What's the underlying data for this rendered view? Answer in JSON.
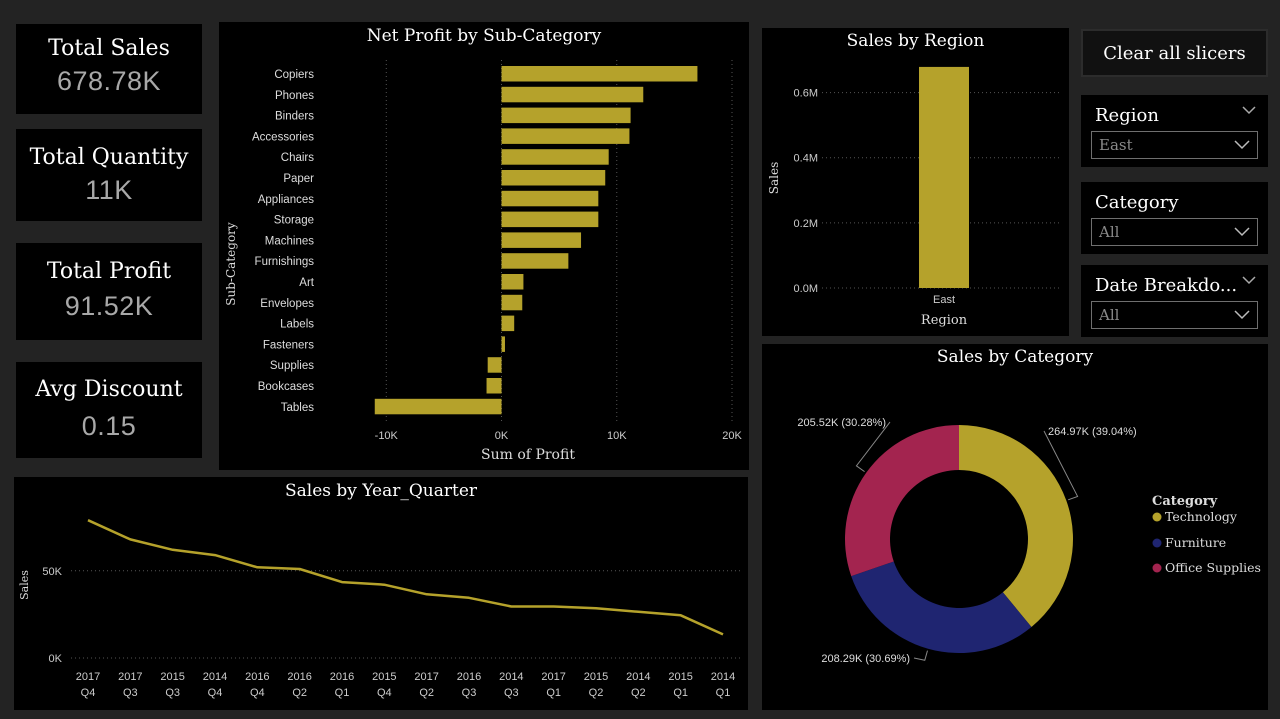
{
  "kpis": {
    "total_sales": {
      "label": "Total Sales",
      "value": "678.78K"
    },
    "total_quantity": {
      "label": "Total Quantity",
      "value": "11K"
    },
    "total_profit": {
      "label": "Total Profit",
      "value": "91.52K"
    },
    "avg_discount": {
      "label": "Avg Discount",
      "value": "0.15"
    }
  },
  "colors": {
    "gold": "#b5a22b",
    "navy": "#1f2571",
    "crimson": "#a3244f",
    "card": "#000000",
    "background": "#232323"
  },
  "slicers": {
    "clear_label": "Clear all slicers",
    "region": {
      "title": "Region",
      "value": "East"
    },
    "category": {
      "title": "Category",
      "value": "All"
    },
    "date": {
      "title": "Date Breakdo...",
      "value": "All"
    }
  },
  "chart_data": [
    {
      "id": "profit_by_subcategory",
      "type": "bar",
      "orientation": "horizontal",
      "title": "Net Profit by Sub-Category",
      "xlabel": "Sum of Profit",
      "ylabel": "Sub-Category",
      "categories": [
        "Copiers",
        "Phones",
        "Binders",
        "Accessories",
        "Chairs",
        "Paper",
        "Appliances",
        "Storage",
        "Machines",
        "Furnishings",
        "Art",
        "Envelopes",
        "Labels",
        "Fasteners",
        "Supplies",
        "Bookcases",
        "Tables"
      ],
      "values": [
        17000,
        12300,
        11200,
        11100,
        9300,
        9000,
        8400,
        8400,
        6900,
        5800,
        1900,
        1800,
        1100,
        300,
        -1200,
        -1300,
        -11000
      ],
      "xlim": [
        -11500,
        20000
      ],
      "xticks": [
        -10000,
        0,
        10000,
        20000
      ],
      "xtick_labels": [
        "-10K",
        "0K",
        "10K",
        "20K"
      ],
      "grid": true
    },
    {
      "id": "sales_by_region",
      "type": "bar",
      "title": "Sales by Region",
      "xlabel": "Region",
      "ylabel": "Sales",
      "categories": [
        "East"
      ],
      "values": [
        678780
      ],
      "ylim": [
        0,
        700000
      ],
      "yticks": [
        0,
        200000,
        400000,
        600000
      ],
      "ytick_labels": [
        "0.0M",
        "0.2M",
        "0.4M",
        "0.6M"
      ],
      "grid": true
    },
    {
      "id": "sales_by_year_quarter",
      "type": "line",
      "title": "Sales by Year_Quarter",
      "ylabel": "Sales",
      "x": [
        "2017 Q4",
        "2017 Q3",
        "2015 Q3",
        "2014 Q4",
        "2016 Q4",
        "2016 Q2",
        "2016 Q1",
        "2015 Q4",
        "2017 Q2",
        "2016 Q3",
        "2014 Q3",
        "2017 Q1",
        "2015 Q2",
        "2014 Q2",
        "2015 Q1",
        "2014 Q1"
      ],
      "x_year": [
        "2017",
        "2017",
        "2015",
        "2014",
        "2016",
        "2016",
        "2016",
        "2015",
        "2017",
        "2016",
        "2014",
        "2017",
        "2015",
        "2014",
        "2015",
        "2014"
      ],
      "x_quarter": [
        "Q4",
        "Q3",
        "Q3",
        "Q4",
        "Q4",
        "Q2",
        "Q1",
        "Q4",
        "Q2",
        "Q3",
        "Q3",
        "Q1",
        "Q2",
        "Q2",
        "Q1",
        "Q1"
      ],
      "values": [
        79000,
        68000,
        62000,
        59000,
        52000,
        51000,
        43500,
        42000,
        36500,
        34500,
        29500,
        29500,
        28500,
        26500,
        24500,
        13500
      ],
      "ylim": [
        0,
        90000
      ],
      "yticks": [
        0,
        50000
      ],
      "ytick_labels": [
        "0K",
        "50K"
      ],
      "grid": true
    },
    {
      "id": "sales_by_category",
      "type": "pie",
      "donut": true,
      "title": "Sales by Category",
      "legend_title": "Category",
      "legend_position": "right",
      "categories": [
        "Technology",
        "Furniture",
        "Office Supplies"
      ],
      "values": [
        264970,
        208290,
        205520
      ],
      "labels": [
        "264.97K (39.04%)",
        "208.29K (30.69%)",
        "205.52K (30.28%)"
      ],
      "colors": [
        "#b5a22b",
        "#1f2571",
        "#a3244f"
      ]
    }
  ]
}
